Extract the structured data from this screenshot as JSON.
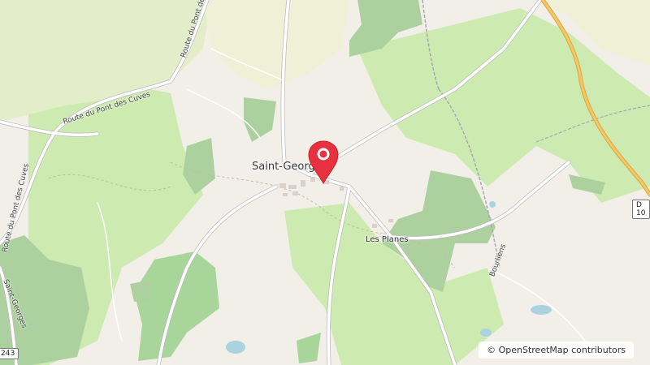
{
  "map": {
    "attribution": "© OpenStreetMap contributors",
    "places": {
      "village": "Saint-Georges",
      "hamlet": "Les Planes"
    },
    "roads": {
      "route_pont_cuves_1": "Route du Pont des Cuves",
      "route_pont_cuves_2": "Route du Pont des Cuves",
      "route_pont_cuves_3": "Route du Pont des Cuves",
      "saint_georges_road": "Saint-Georges",
      "bourliens": "Bourliens"
    },
    "shields": {
      "d_road": "D 10",
      "left_road": "243"
    },
    "colors": {
      "background": "#f2efe9",
      "meadow": "#cdebb0",
      "forest": "#add19e",
      "water": "#aad3df",
      "marker": "#e8313e",
      "main_road": "#f7c860"
    },
    "marker_icon": "map-pin-icon"
  }
}
